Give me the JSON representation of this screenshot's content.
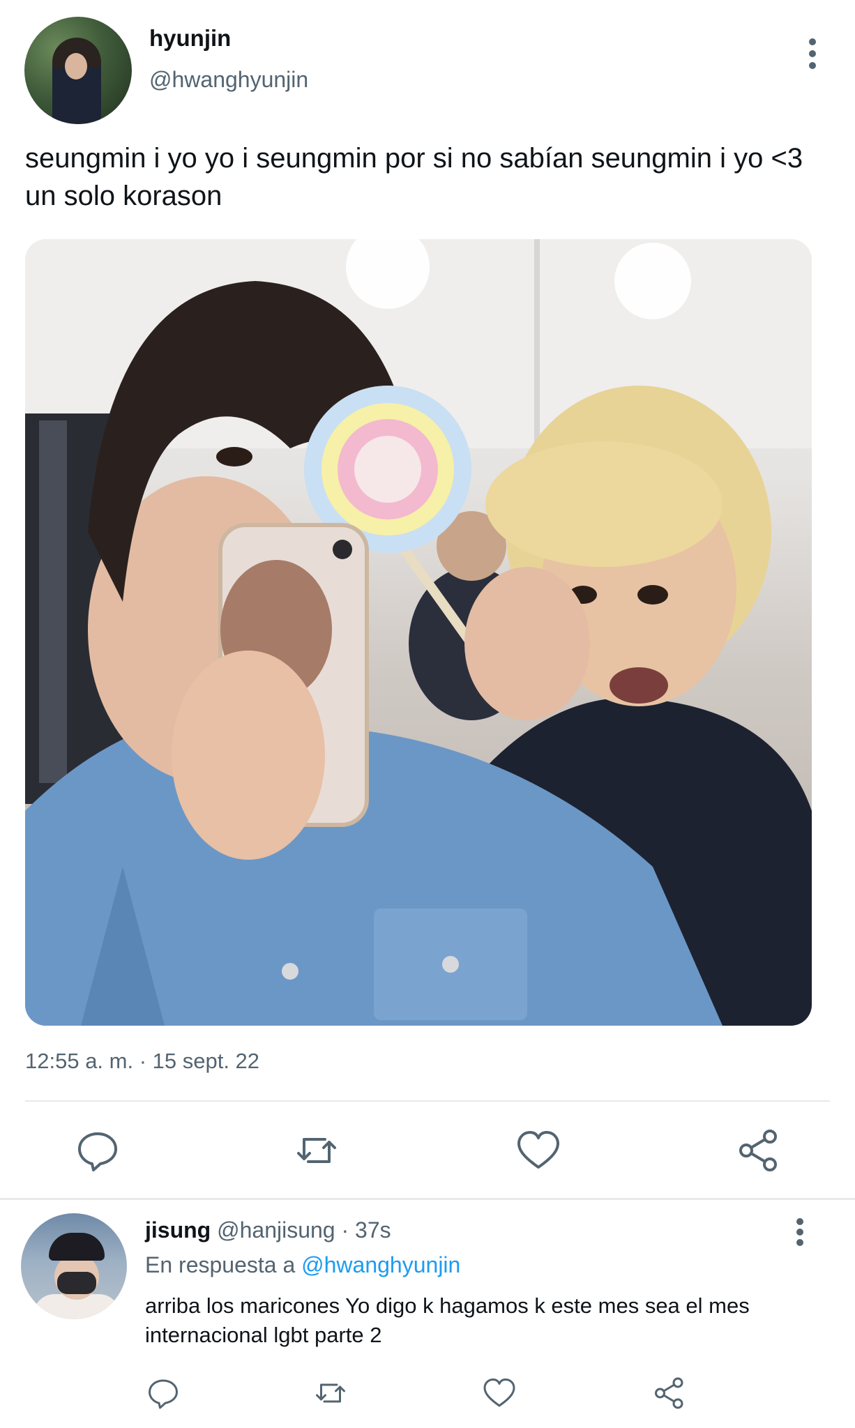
{
  "tweet": {
    "display_name": "hyunjin",
    "handle": "@hwanghyunjin",
    "text": "seungmin i yo yo i seungmin por si no sabían seungmin i yo <3 un solo korason",
    "timestamp": "12:55 a. m. · 15 sept. 22",
    "avatar_icon": "avatar-photo",
    "more_icon": "more-vertical-icon",
    "actions": [
      "reply-icon",
      "retweet-icon",
      "like-icon",
      "share-icon"
    ]
  },
  "reply": {
    "display_name": "jisung",
    "handle": "@hanjisung",
    "time": "· 37s",
    "reply_to_prefix": "En respuesta a",
    "reply_to_handle": "@hwanghyunjin",
    "text": "arriba los maricones Yo digo k hagamos k este mes sea el mes internacional lgbt parte 2",
    "actions": [
      "reply-icon",
      "retweet-icon",
      "like-icon",
      "share-icon"
    ]
  },
  "colors": {
    "text_primary": "#0f1419",
    "text_secondary": "#536471",
    "link": "#1d9bf0",
    "icon": "#536471",
    "divider": "#e7e9ea"
  }
}
